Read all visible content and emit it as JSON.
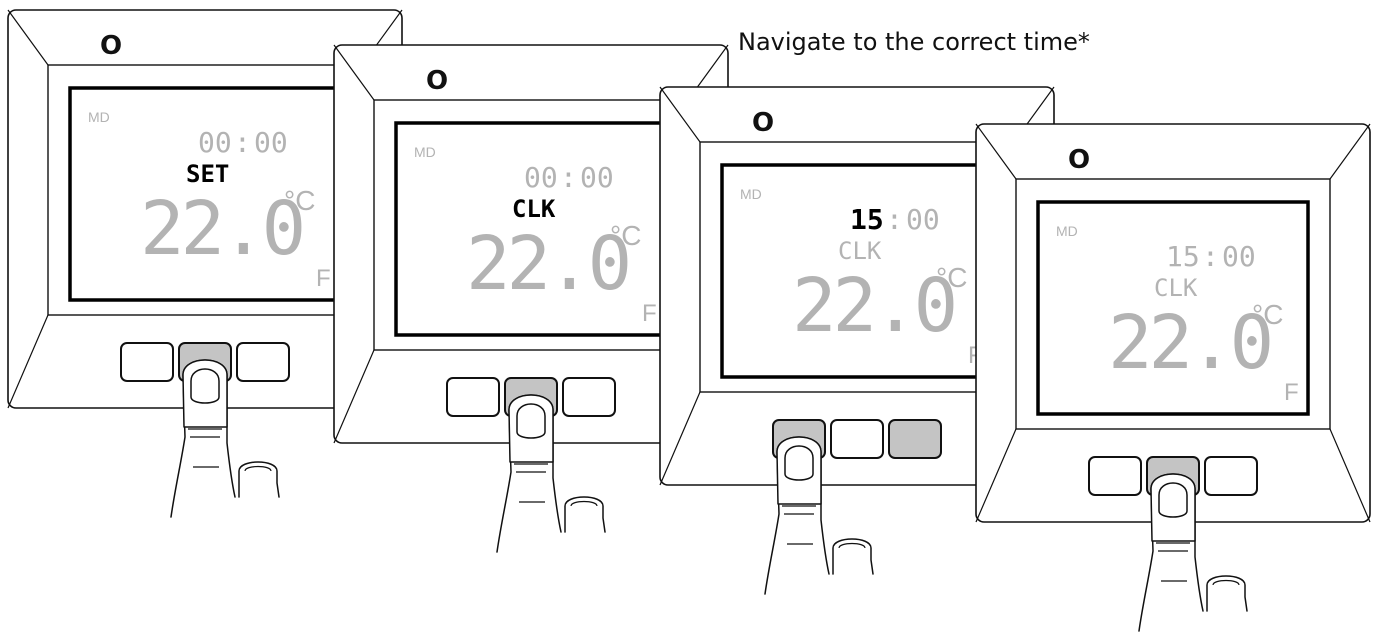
{
  "caption": "Navigate to the correct time*",
  "colors": {
    "outline": "#111111",
    "lcd_active": "#000000",
    "lcd_dim": "#b3b3b3",
    "button_pressed": "#c4c4c4",
    "button_idle": "#ffffff"
  },
  "icons": [
    "power-icon",
    "pointing-hand-icon"
  ],
  "steps": [
    {
      "power_symbol": "O",
      "lcd": {
        "mode": "MD",
        "time_hours": "00",
        "time_colon": ":",
        "time_minutes": "00",
        "status": "SET",
        "temperature": "22.0",
        "unit": "°C",
        "flag": "F",
        "active": "status"
      },
      "buttons": [
        {
          "pressed": false
        },
        {
          "pressed": true
        },
        {
          "pressed": false
        }
      ],
      "finger_on": 1
    },
    {
      "power_symbol": "O",
      "lcd": {
        "mode": "MD",
        "time_hours": "00",
        "time_colon": ":",
        "time_minutes": "00",
        "status": "CLK",
        "temperature": "22.0",
        "unit": "°C",
        "flag": "F",
        "active": "status"
      },
      "buttons": [
        {
          "pressed": false
        },
        {
          "pressed": true
        },
        {
          "pressed": false
        }
      ],
      "finger_on": 1
    },
    {
      "power_symbol": "O",
      "lcd": {
        "mode": "MD",
        "time_hours": "15",
        "time_colon": ":",
        "time_minutes": "00",
        "status": "CLK",
        "temperature": "22.0",
        "unit": "°C",
        "flag": "F",
        "active": "hours"
      },
      "buttons": [
        {
          "pressed": true
        },
        {
          "pressed": false
        },
        {
          "pressed": true
        }
      ],
      "finger_on": 0
    },
    {
      "power_symbol": "O",
      "lcd": {
        "mode": "MD",
        "time_hours": "15",
        "time_colon": ":",
        "time_minutes": "00",
        "status": "CLK",
        "temperature": "22.0",
        "unit": "°C",
        "flag": "F",
        "active": "none"
      },
      "buttons": [
        {
          "pressed": false
        },
        {
          "pressed": true
        },
        {
          "pressed": false
        }
      ],
      "finger_on": 1
    }
  ]
}
